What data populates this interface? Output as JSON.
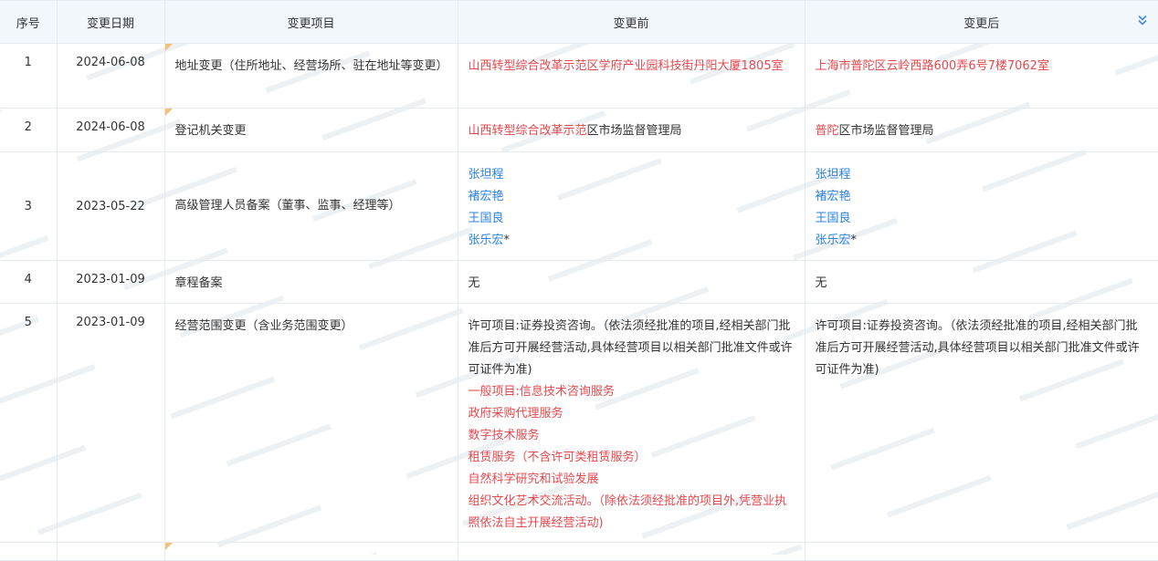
{
  "table": {
    "headers": {
      "seq": "序号",
      "date": "变更日期",
      "item": "变更项目",
      "before": "变更前",
      "after": "变更后"
    },
    "expand_icon": "double-chevron-down-icon",
    "rows": [
      {
        "seq": "1",
        "date": "2024-06-08",
        "item": "地址变更（住所地址、经营场所、驻在地址等变更）",
        "before": [
          [
            {
              "t": "山西转型综合改革示范区学府产业园科技街丹阳大厦1805室",
              "c": "red"
            }
          ]
        ],
        "after": [
          [
            {
              "t": "上海市普陀区云岭西路600弄6号7楼7062室",
              "c": "red"
            }
          ]
        ]
      },
      {
        "seq": "2",
        "date": "2024-06-08",
        "item": "登记机关变更",
        "before": [
          [
            {
              "t": "山西转型综合改革示范",
              "c": "red"
            },
            {
              "t": "区市场监督管理局",
              "c": ""
            }
          ]
        ],
        "after": [
          [
            {
              "t": "普陀",
              "c": "red"
            },
            {
              "t": "区市场监督管理局",
              "c": ""
            }
          ]
        ]
      },
      {
        "seq": "3",
        "date": "2023-05-22",
        "item": "高级管理人员备案（董事、监事、经理等）",
        "before": [
          [
            {
              "t": "张坦程",
              "c": "blue"
            }
          ],
          [
            {
              "t": "褚宏艳",
              "c": "blue"
            }
          ],
          [
            {
              "t": "王国良",
              "c": "blue"
            }
          ],
          [
            {
              "t": "张乐宏",
              "c": "blue"
            },
            {
              "t": "*",
              "c": ""
            }
          ]
        ],
        "after": [
          [
            {
              "t": "张坦程",
              "c": "blue"
            }
          ],
          [
            {
              "t": "褚宏艳",
              "c": "blue"
            }
          ],
          [
            {
              "t": "王国良",
              "c": "blue"
            }
          ],
          [
            {
              "t": "张乐宏",
              "c": "blue"
            },
            {
              "t": "*",
              "c": ""
            }
          ]
        ]
      },
      {
        "seq": "4",
        "date": "2023-01-09",
        "item": "章程备案",
        "before": [
          [
            {
              "t": "无",
              "c": ""
            }
          ]
        ],
        "after": [
          [
            {
              "t": "无",
              "c": ""
            }
          ]
        ]
      },
      {
        "seq": "5",
        "date": "2023-01-09",
        "item": "经营范围变更（含业务范围变更）",
        "before": [
          [
            {
              "t": "许可项目:证券投资咨询。（依法须经批准的项目,经相关部门批准后方可开展经营活动,具体经营项目以相关部门批准文件或许可证件为准)",
              "c": ""
            }
          ],
          [
            {
              "t": "一般项目:信息技术咨询服务",
              "c": "red"
            }
          ],
          [
            {
              "t": "政府采购代理服务",
              "c": "red"
            }
          ],
          [
            {
              "t": "数字技术服务",
              "c": "red"
            }
          ],
          [
            {
              "t": "租赁服务（不含许可类租赁服务）",
              "c": "red"
            }
          ],
          [
            {
              "t": "自然科学研究和试验发展",
              "c": "red"
            }
          ],
          [
            {
              "t": "组织文化艺术交流活动。（除依法须经批准的项目外,凭营业执照依法自主开展经营活动)",
              "c": "red"
            }
          ]
        ],
        "after": [
          [
            {
              "t": "许可项目:证券投资咨询。（依法须经批准的项目,经相关部门批准后方可开展经营活动,具体经营项目以相关部门批准文件或许可证件为准)",
              "c": ""
            }
          ]
        ]
      }
    ]
  },
  "colors": {
    "header_bg": "#f2f7fc",
    "border": "#e6ebf1",
    "highlight_red": "#e5484d",
    "person_blue": "#2a82e4",
    "corner_mark": "#f3c17a"
  }
}
